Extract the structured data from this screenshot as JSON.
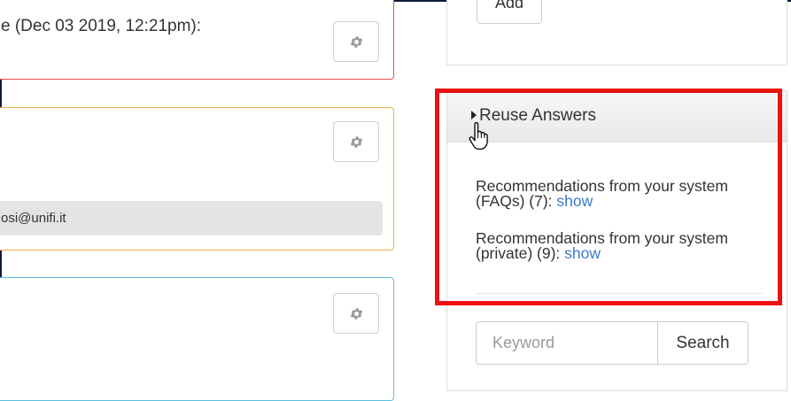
{
  "cards": {
    "red": {
      "text": "e (Dec 03 2019, 12:21pm):",
      "color": "#e8504a"
    },
    "orange": {
      "email": "osi@unifi.it",
      "color": "#f0ad4e"
    },
    "blue": {
      "color": "#5bc0de"
    }
  },
  "right_panel": {
    "add_button_label": "Add",
    "reuse_answers": {
      "title": "Reuse Answers",
      "recommendations": [
        {
          "text": "Recommendations from your system (FAQs) (7): ",
          "link": "show"
        },
        {
          "text": "Recommendations from your system (private) (9): ",
          "link": "show"
        }
      ]
    },
    "search": {
      "placeholder": "Keyword",
      "button_label": "Search"
    }
  },
  "annotation": {
    "highlight_color": "#ee1111"
  },
  "icons": {
    "gear": "gear-icon",
    "caret": "caret-right-icon",
    "cursor": "hand-pointer-icon"
  }
}
